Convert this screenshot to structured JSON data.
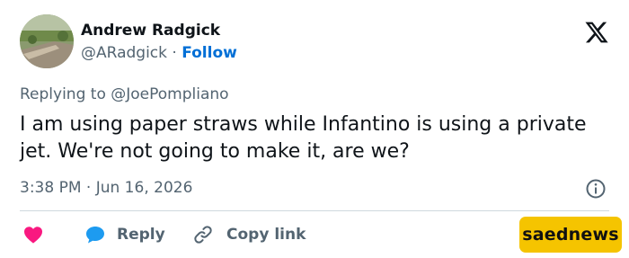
{
  "author": {
    "name": "Andrew Radgick",
    "handle": "@ARadgick",
    "separator": "·",
    "follow_label": "Follow"
  },
  "reply_context": {
    "prefix": "Replying to",
    "mention": "@JoePompliano"
  },
  "tweet": {
    "text": "I am using paper straws while Infantino is using a private jet. We're not going to make it, are we?",
    "time": "3:38 PM",
    "separator": "·",
    "date": "Jun 16, 2026"
  },
  "actions": {
    "reply_label": "Reply",
    "copy_label": "Copy link"
  },
  "watermark": {
    "text": "saednews"
  },
  "icons": {
    "brand": "x-logo-icon",
    "info": "info-icon",
    "like": "heart-icon",
    "reply": "reply-bubble-icon",
    "copy": "link-icon"
  },
  "colors": {
    "follow": "#006fd6",
    "secondary_text": "#536471",
    "primary_text": "#0f1419",
    "heart": "#f91880",
    "reply_bubble": "#1d9bf0",
    "watermark_bg": "#f5c400",
    "divider": "#cfd9de"
  }
}
